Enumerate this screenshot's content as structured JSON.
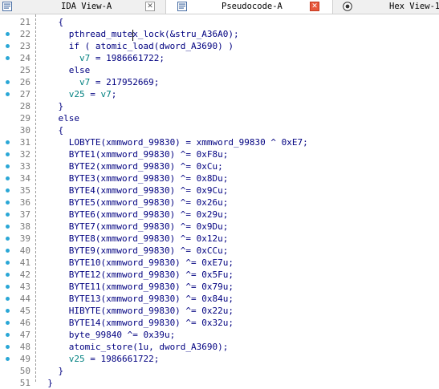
{
  "tabs": [
    {
      "label": "IDA View-A",
      "icon": "ida-view-icon",
      "close": "close-icon",
      "active": false
    },
    {
      "label": "Pseudocode-A",
      "icon": "pseudocode-icon",
      "close": "close-icon",
      "active": true
    },
    {
      "label": "Hex View-1",
      "icon": "hex-view-icon",
      "active": false
    }
  ],
  "close_glyph": "✕",
  "code": {
    "lines": [
      {
        "num": "21",
        "text": "    {",
        "dot": false
      },
      {
        "num": "22",
        "text": "      pthread_mutex_lock(&stru_A36A0);",
        "dot": true
      },
      {
        "num": "23",
        "text": "      if ( atomic_load(dword_A3690) )",
        "dot": true
      },
      {
        "num": "24",
        "text": "        v7 = 1986661722;",
        "dot": true
      },
      {
        "num": "25",
        "text": "      else",
        "dot": false
      },
      {
        "num": "26",
        "text": "        v7 = 217952669;",
        "dot": true
      },
      {
        "num": "27",
        "text": "      v25 = v7;",
        "dot": true
      },
      {
        "num": "28",
        "text": "    }",
        "dot": false
      },
      {
        "num": "29",
        "text": "    else",
        "dot": false
      },
      {
        "num": "30",
        "text": "    {",
        "dot": false
      },
      {
        "num": "31",
        "text": "      LOBYTE(xmmword_99830) = xmmword_99830 ^ 0xE7;",
        "dot": true
      },
      {
        "num": "32",
        "text": "      BYTE1(xmmword_99830) ^= 0xF8u;",
        "dot": true
      },
      {
        "num": "33",
        "text": "      BYTE2(xmmword_99830) ^= 0xCu;",
        "dot": true
      },
      {
        "num": "34",
        "text": "      BYTE3(xmmword_99830) ^= 0x8Du;",
        "dot": true
      },
      {
        "num": "35",
        "text": "      BYTE4(xmmword_99830) ^= 0x9Cu;",
        "dot": true
      },
      {
        "num": "36",
        "text": "      BYTE5(xmmword_99830) ^= 0x26u;",
        "dot": true
      },
      {
        "num": "37",
        "text": "      BYTE6(xmmword_99830) ^= 0x29u;",
        "dot": true
      },
      {
        "num": "38",
        "text": "      BYTE7(xmmword_99830) ^= 0x9Du;",
        "dot": true
      },
      {
        "num": "39",
        "text": "      BYTE8(xmmword_99830) ^= 0x12u;",
        "dot": true
      },
      {
        "num": "40",
        "text": "      BYTE9(xmmword_99830) ^= 0xCCu;",
        "dot": true
      },
      {
        "num": "41",
        "text": "      BYTE10(xmmword_99830) ^= 0xE7u;",
        "dot": true
      },
      {
        "num": "42",
        "text": "      BYTE12(xmmword_99830) ^= 0x5Fu;",
        "dot": true
      },
      {
        "num": "43",
        "text": "      BYTE11(xmmword_99830) ^= 0x79u;",
        "dot": true
      },
      {
        "num": "44",
        "text": "      BYTE13(xmmword_99830) ^= 0x84u;",
        "dot": true
      },
      {
        "num": "45",
        "text": "      HIBYTE(xmmword_99830) ^= 0x22u;",
        "dot": true
      },
      {
        "num": "46",
        "text": "      BYTE14(xmmword_99830) ^= 0x32u;",
        "dot": true
      },
      {
        "num": "47",
        "text": "      byte_99840 ^= 0x39u;",
        "dot": true
      },
      {
        "num": "48",
        "text": "      atomic_store(1u, dword_A3690);",
        "dot": true
      },
      {
        "num": "49",
        "text": "      v25 = 1986661722;",
        "dot": true
      },
      {
        "num": "50",
        "text": "    }",
        "dot": false
      },
      {
        "num": "51",
        "text": "  }",
        "dot": false
      }
    ]
  },
  "colors": {
    "code_text": "#000080",
    "variable": "#008080",
    "line_number": "#7a7a7a",
    "breakpoint_dot": "#2aa7d6",
    "active_close": "#e8583c"
  }
}
